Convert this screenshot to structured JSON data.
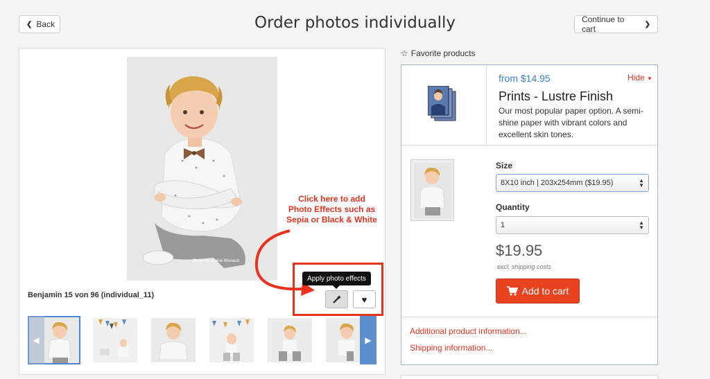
{
  "header": {
    "back_label": "Back",
    "title": "Order photos individually",
    "continue_label": "Continue to cart"
  },
  "photo": {
    "caption": "Benjamin 15 von 96 (individual_11)",
    "watermark": "Photo by Janine Wisnock"
  },
  "annotation": {
    "line1": "Click here to add",
    "line2": "Photo Effects such as",
    "line3": "Sepia or Black & White"
  },
  "actions": {
    "tooltip": "Apply photo effects"
  },
  "thumbnails": {
    "count": 6
  },
  "favorites": {
    "header": "Favorite products"
  },
  "product": {
    "from_price": "from $14.95",
    "hide_label": "Hide",
    "title": "Prints - Lustre Finish",
    "description": "Our most popular paper option. A semi-shine paper with vibrant colors and excellent skin tones.",
    "size_label": "Size",
    "size_value": "8X10 inch | 203x254mm ($19.95)",
    "quantity_label": "Quantity",
    "quantity_value": "1",
    "price": "$19.95",
    "shipping_note": "excl. shipping costs",
    "add_to_cart_label": "Add to cart",
    "additional_info_link": "Additional product information...",
    "shipping_info_link": "Shipping information..."
  },
  "colors": {
    "accent_red": "#e8321e",
    "link_blue": "#3a80c8",
    "cart_button": "#e8421e"
  }
}
